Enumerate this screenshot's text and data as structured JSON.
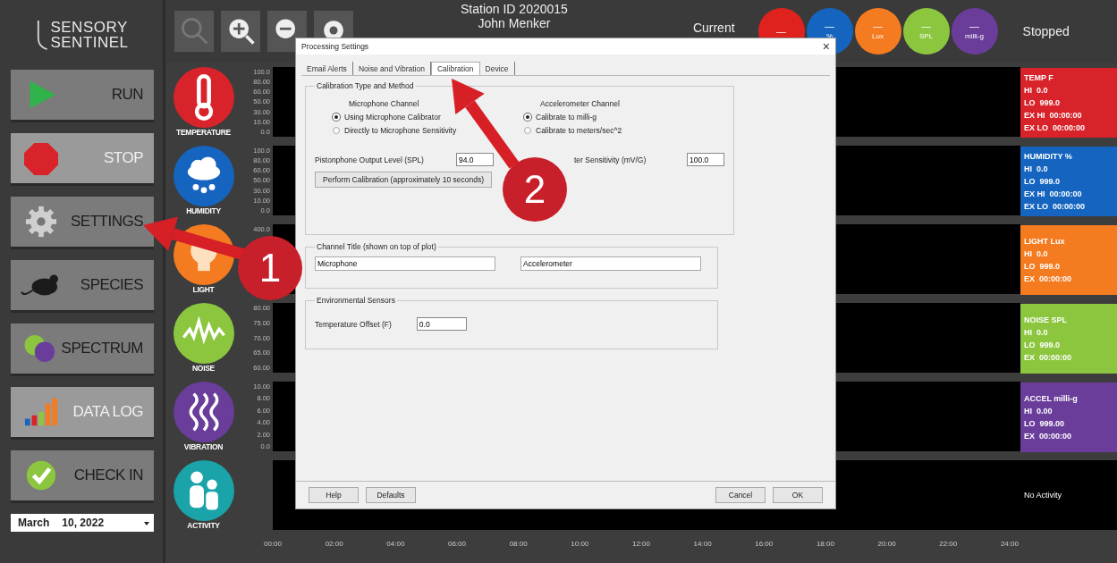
{
  "logo": {
    "line1": "SENSORY",
    "line2": "SENTINEL"
  },
  "nav": [
    {
      "label": "RUN",
      "kind": "run"
    },
    {
      "label": "STOP",
      "kind": "stop"
    },
    {
      "label": "SETTINGS",
      "kind": "settings"
    },
    {
      "label": "SPECIES",
      "kind": "species"
    },
    {
      "label": "SPECTRUM",
      "kind": "spectrum"
    },
    {
      "label": "DATA LOG",
      "kind": "datalog"
    },
    {
      "label": "CHECK IN",
      "kind": "checkin"
    }
  ],
  "date": {
    "month": "March",
    "day": "10, 2022"
  },
  "toolbar": [
    {
      "kind": "search"
    },
    {
      "kind": "zoom-in"
    },
    {
      "kind": "zoom-out"
    },
    {
      "kind": "record"
    }
  ],
  "header": {
    "station": "Station ID 2020015",
    "user": "John Menker",
    "current": "Current",
    "status": "Stopped"
  },
  "readouts": [
    {
      "value": "—",
      "color": "#e0221f"
    },
    {
      "value": "—",
      "unit": "%",
      "color": "#1565c0"
    },
    {
      "value": "—",
      "unit": "Lux",
      "color": "#f47b20"
    },
    {
      "value": "—",
      "unit": "SPL",
      "color": "#8cc63f"
    },
    {
      "value": "—",
      "unit": "milli-g",
      "color": "#6a3d9a"
    }
  ],
  "sensors": [
    {
      "label": "TEMPERATURE",
      "kind": "temperature",
      "color": "#d8232a",
      "ticks": [
        "100.0",
        "80.00",
        "60.00",
        "50.00",
        "30.00",
        "10.00",
        "0.0"
      ],
      "stats": [
        "TEMP F",
        "HI  0.0",
        "LO  999.0",
        "EX HI  00:00:00",
        "EX LO  00:00:00"
      ]
    },
    {
      "label": "HUMIDITY",
      "kind": "humidity",
      "color": "#1565c0",
      "ticks": [
        "100.0",
        "80.00",
        "60.00",
        "50.00",
        "30.00",
        "10.00",
        "0.0"
      ],
      "stats": [
        "HUMIDITY %",
        "HI  0.0",
        "LO  999.0",
        "EX HI  00:00:00",
        "EX LO  00:00:00"
      ]
    },
    {
      "label": "LIGHT",
      "kind": "light",
      "color": "#f47b20",
      "ticks": [
        "400.0"
      ],
      "stats": [
        "LIGHT Lux",
        "HI  0.0",
        "LO  999.0",
        "EX  00:00:00"
      ]
    },
    {
      "label": "NOISE",
      "kind": "noise",
      "color": "#8cc63f",
      "ticks": [
        "80.00",
        "75.00",
        "70.00",
        "65.00",
        "60.00"
      ],
      "stats": [
        "NOISE SPL",
        "HI  0.0",
        "LO  999.0",
        "EX  00:00:00"
      ]
    },
    {
      "label": "VIBRATION",
      "kind": "vibration",
      "color": "#6a3d9a",
      "ticks": [
        "10.00",
        "8.00",
        "6.00",
        "4.00",
        "2.00",
        "0.0"
      ],
      "stats": [
        "ACCEL milli-g",
        "HI  0.00",
        "LO  999.00",
        "EX  00:00:00"
      ]
    },
    {
      "label": "ACTIVITY",
      "kind": "activity",
      "color": "#1aa3a8",
      "stats": [
        "No Activity"
      ]
    }
  ],
  "x_ticks": [
    "00:00",
    "02:00",
    "04:00",
    "06:00",
    "08:00",
    "10:00",
    "12:00",
    "14:00",
    "16:00",
    "18:00",
    "20:00",
    "22:00",
    "24:00"
  ],
  "dialog": {
    "title": "Processing Settings",
    "close": "×",
    "tabs": [
      {
        "label": "Email Alerts",
        "selected": false
      },
      {
        "label": "Noise and Vibration",
        "selected": false
      },
      {
        "label": "Calibration",
        "selected": true
      },
      {
        "label": "Device",
        "selected": false
      }
    ],
    "calibration_group": {
      "title": "Calibration Type and Method",
      "microphone": {
        "heading": "Microphone Channel",
        "options": [
          {
            "label": "Using Microphone Calibrator",
            "selected": true
          },
          {
            "label": "Directly to Microphone Sensitivity",
            "selected": false
          }
        ]
      },
      "accelerometer": {
        "heading": "Accelerometer Channel",
        "options": [
          {
            "label": "Calibrate to milli-g",
            "selected": true
          },
          {
            "label": "Calibrate to meters/sec^2",
            "selected": false
          }
        ]
      },
      "pistonphone_label": "Pistonphone Output Level (SPL)",
      "pistonphone_value": "94.0",
      "sensitivity_label": "ter Sensitivity (mV/G)",
      "sensitivity_value": "100.0",
      "calibrate_button": "Perform Calibration (approximately 10 seconds)"
    },
    "channel_group": {
      "title": "Channel Title (shown on top of plot)",
      "values": [
        "Microphone",
        "Accelerometer"
      ]
    },
    "env_group": {
      "title": "Environmental Sensors",
      "label": "Temperature Offset (F)",
      "value": "0.0"
    },
    "left_buttons": [
      "Help",
      "Defaults"
    ],
    "right_buttons": [
      "Cancel",
      "OK"
    ]
  },
  "callouts": [
    {
      "number": "1"
    },
    {
      "number": "2"
    }
  ]
}
